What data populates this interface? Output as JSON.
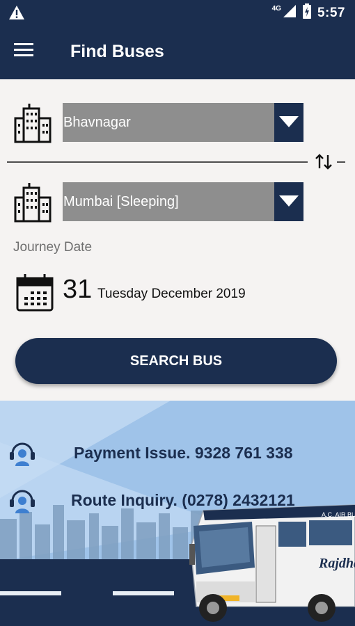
{
  "status_bar": {
    "network": "4G",
    "time": "5:57",
    "icons": [
      "warning-icon",
      "signal-icon",
      "battery-icon"
    ]
  },
  "app_bar": {
    "title": "Find Buses",
    "menu_icon": "menu-icon"
  },
  "form": {
    "from_city": "Bhavnagar",
    "to_city": "Mumbai [Sleeping]",
    "journey_date_label": "Journey Date",
    "date_day": "31",
    "date_rest": "Tuesday December 2019",
    "search_button_label": "SEARCH BUS"
  },
  "support": {
    "payment": "Payment Issue. 9328 761 338",
    "route": "Route Inquiry. (0278) 2432121"
  },
  "bus_texts": {
    "brand": "Rajdha",
    "ac_label": "A.C. AIR BUS"
  },
  "colors": {
    "primary": "#1b2e4f",
    "background": "#f5f3f2",
    "select_bg": "#8e8e8e",
    "sky": "#9fc3e9"
  }
}
